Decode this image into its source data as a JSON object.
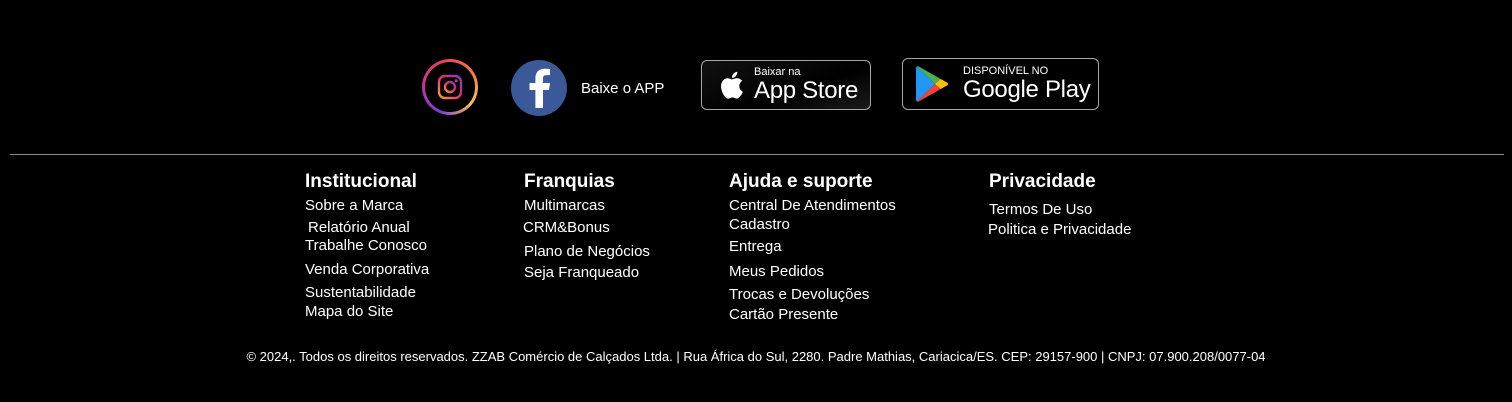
{
  "social": {
    "instagram_icon": "instagram-icon",
    "facebook_icon": "facebook-icon",
    "app_label": "Baixe o APP"
  },
  "app_store": {
    "small": "Baixar na",
    "big": "App Store"
  },
  "google_play": {
    "small": "DISPONÍVEL NO",
    "big": "Google Play"
  },
  "columns": {
    "institucional": {
      "title": "Institucional",
      "links": [
        "Sobre a Marca",
        "Relatório Anual",
        "Trabalhe Conosco",
        "Venda Corporativa",
        "Sustentabilidade",
        "Mapa do Site"
      ]
    },
    "franquias": {
      "title": "Franquias",
      "links": [
        "Multimarcas",
        "CRM&Bonus",
        "Plano de Negócios",
        "Seja Franqueado"
      ]
    },
    "ajuda": {
      "title": "Ajuda e suporte",
      "links": [
        "Central De Atendimentos",
        "Cadastro",
        "Entrega",
        "Meus Pedidos",
        "Trocas e Devoluções",
        "Cartão Presente"
      ]
    },
    "privacidade": {
      "title": "Privacidade",
      "links": [
        "Termos De Uso",
        "Politica e Privacidade"
      ]
    }
  },
  "copyright": "© 2024,. Todos os direitos reservados. ZZAB Comércio de Calçados Ltda. | Rua África do Sul, 2280. Padre Mathias, Cariacica/ES. CEP: 29157-900 | CNPJ: 07.900.208/0077-04"
}
